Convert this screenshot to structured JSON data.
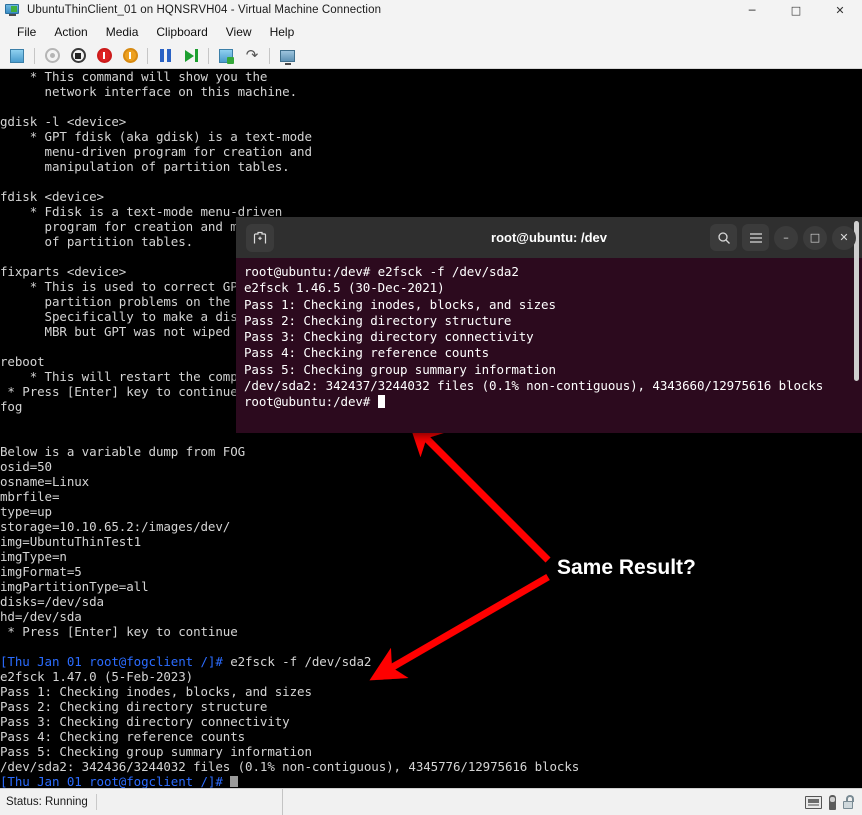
{
  "window": {
    "title": "UbuntuThinClient_01 on HQNSRVH04 - Virtual Machine Connection",
    "icon": "virtual-machine-icon",
    "minimize_label": "─",
    "maximize_label": "□",
    "close_label": "✕"
  },
  "menubar": {
    "items": [
      "File",
      "Action",
      "Media",
      "Clipboard",
      "View",
      "Help"
    ]
  },
  "toolbar": {
    "buttons": [
      {
        "name": "ctrl-alt-delete-icon",
        "title": "Ctrl+Alt+Delete"
      },
      {
        "name": "start-icon",
        "title": "Start"
      },
      {
        "name": "turn-off-icon",
        "title": "Turn Off"
      },
      {
        "name": "shut-down-icon",
        "title": "Shut Down"
      },
      {
        "name": "save-state-icon",
        "title": "Save"
      },
      {
        "name": "pause-icon",
        "title": "Pause"
      },
      {
        "name": "reset-icon",
        "title": "Reset"
      },
      {
        "name": "checkpoint-icon",
        "title": "Checkpoint"
      },
      {
        "name": "revert-icon",
        "title": "Revert"
      },
      {
        "name": "enhanced-session-icon",
        "title": "Enhanced Session"
      }
    ]
  },
  "fog_console": {
    "lines": [
      "    * This command will show you the",
      "      network interface on this machine.",
      "",
      "gdisk -l <device>",
      "    * GPT fdisk (aka gdisk) is a text-mode",
      "      menu-driven program for creation and",
      "      manipulation of partition tables.",
      "",
      "fdisk <device>",
      "    * Fdisk is a text-mode menu-driven",
      "      program for creation and manipulation",
      "      of partition tables.",
      "",
      "fixparts <device>",
      "    * This is used to correct GPT/MBR",
      "      partition problems on the device.",
      "      Specifically to make a disk from",
      "      MBR but GPT was not wiped properly.",
      "",
      "reboot",
      "    * This will restart the computer",
      " * Press [Enter] key to continue",
      "fog",
      "",
      "",
      "Below is a variable dump from FOG",
      "osid=50",
      "osname=Linux",
      "mbrfile=",
      "type=up",
      "storage=10.10.65.2:/images/dev/",
      "img=UbuntuThinTest1",
      "imgType=n",
      "imgFormat=5",
      "imgPartitionType=all",
      "disks=/dev/sda",
      "hd=/dev/sda",
      " * Press [Enter] key to continue",
      ""
    ],
    "session": {
      "prompt": "[Thu Jan 01 root@fogclient /]# ",
      "command": "e2fsck -f /dev/sda2",
      "output": [
        "e2fsck 1.47.0 (5-Feb-2023)",
        "Pass 1: Checking inodes, blocks, and sizes",
        "Pass 2: Checking directory structure",
        "Pass 3: Checking directory connectivity",
        "Pass 4: Checking reference counts",
        "Pass 5: Checking group summary information",
        "/dev/sda2: 342436/3244032 files (0.1% non-contiguous), 4345776/12975616 blocks"
      ],
      "final_prompt": "[Thu Jan 01 root@fogclient /]#"
    },
    "prompt_color": "#2b6cff",
    "text_color": "#d4d4d4",
    "background": "#000000"
  },
  "ubuntu_terminal": {
    "title": "root@ubuntu: /dev",
    "new_tab_icon": "new-tab-icon",
    "search_icon": "search-icon",
    "menu_icon": "hamburger-menu-icon",
    "minimize_label": "–",
    "maximize_label": "□",
    "close_label": "✕",
    "background": "#2c0a1e",
    "header_background": "#2f2f2f",
    "lines": [
      "root@ubuntu:/dev# e2fsck -f /dev/sda2",
      "e2fsck 1.46.5 (30-Dec-2021)",
      "Pass 1: Checking inodes, blocks, and sizes",
      "Pass 2: Checking directory structure",
      "Pass 3: Checking directory connectivity",
      "Pass 4: Checking reference counts",
      "Pass 5: Checking group summary information",
      "/dev/sda2: 342437/3244032 files (0.1% non-contiguous), 4343660/12975616 blocks"
    ],
    "final_prompt": "root@ubuntu:/dev# "
  },
  "annotation": {
    "label": "Same Result?",
    "arrow_color": "#ff0000",
    "arrow_count": 2
  },
  "statusbar": {
    "status": "Status: Running",
    "icons": [
      "keyboard-icon",
      "usb-icon",
      "lock-icon"
    ]
  }
}
